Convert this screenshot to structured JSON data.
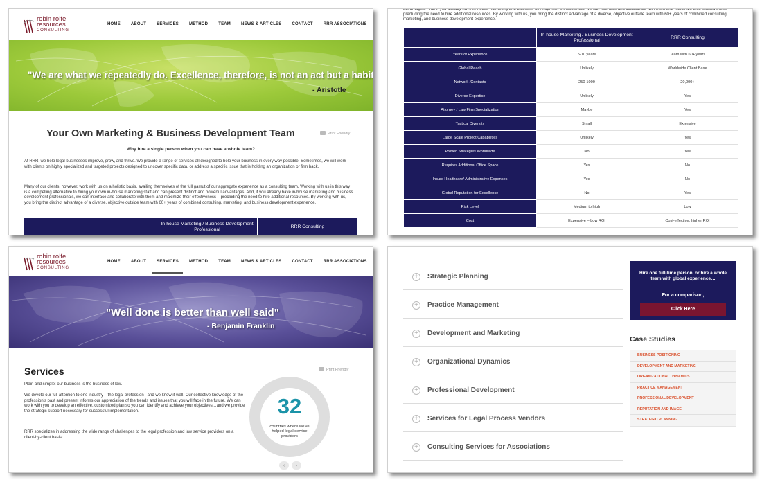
{
  "logo": {
    "line1": "robin rolfe",
    "line2": "resources",
    "line3": "CONSULTING"
  },
  "nav": [
    "HOME",
    "ABOUT",
    "SERVICES",
    "METHOD",
    "TEAM",
    "NEWS & ARTICLES",
    "CONTACT",
    "RRR ASSOCIATIONS"
  ],
  "panel1": {
    "quote": "\"We are what we repeatedly do. Excellence, therefore, is not an act but a habit\"",
    "author": "- Aristotle",
    "title": "Your Own Marketing & Business Development Team",
    "print": "Print Friendly",
    "subhead": "Why hire a single person when you can have a whole team?",
    "para1": "At RRR, we help legal businesses improve, grow, and thrive.  We provide a range of services all designed to help your business in every way possible. Sometimes, we will work with clients on highly specialized and targeted projects designed to uncover specific data, or address a specific issue that is holding an organization or firm back.",
    "para2": "Many of our clients, however, work with us on a holistic basis, availing themselves of the full gamut of our aggregate experience as a consulting team.   Working with us in this way is a compelling alternative to hiring your own in-house marketing staff and can present distinct and powerful advantages.  And, if you already have in-house marketing and business development professionals, we can interface and collaborate with them and maximize their effectiveness – precluding the need to hire additional resources. By working with us, you bring the distinct advantage of a diverse, objective outside team with 60+ years of combined consulting, marketing, and business development experience.",
    "table_head": [
      "",
      "In-house Marketing / Business Development Professional",
      "RRR Consulting"
    ]
  },
  "panel2": {
    "top_text": "advantages.  And, if you already have in-house marketing and business development professionals, we can interface and collaborate with them and maximize their effectiveness – precluding the need to hire additional resources. By working with us, you bring the distinct advantage of a diverse, objective outside team with 60+ years of combined consulting, marketing, and business development experience.",
    "headers": [
      "",
      "In-house Marketing / Business Development Professional",
      "RRR Consulting"
    ],
    "rows": [
      [
        "Years of Experience",
        "5-10 years",
        "Team with 60+  years"
      ],
      [
        "Global Reach",
        "Unlikely",
        "Worldwide Client Base"
      ],
      [
        "Network /Contacts",
        "250-1000",
        "20,000+"
      ],
      [
        "Diverse Expertise",
        "Unlikely",
        "Yes"
      ],
      [
        "Attorney / Law Firm Specialization",
        "Maybe",
        "Yes"
      ],
      [
        "Tactical Diversity",
        "Small",
        "Extensive"
      ],
      [
        "Large Scale Project Capabilities",
        "Unlikely",
        "Yes"
      ],
      [
        "Proven Strategies Worldwide",
        "No",
        "Yes"
      ],
      [
        "Requires Additional Office Space",
        "Yes",
        "No"
      ],
      [
        "Incurs Healthcare/ Administrative Expenses",
        "Yes",
        "No"
      ],
      [
        "Global Reputation for Excellence",
        "No",
        "Yes"
      ],
      [
        "Risk Level",
        "Medium to high",
        "Low"
      ],
      [
        "Cost",
        "Expensive – Low ROI",
        "Cost-effective, higher ROI"
      ]
    ]
  },
  "panel3": {
    "quote": "\"Well done is better than well said\"",
    "author": "- Benjamin Franklin",
    "title": "Services",
    "print": "Print Friendly",
    "para1": "Plain and simple: our business is the business of law.",
    "para2": "We devote our full attention to one industry – the legal profession –and  we know it well. Our collective knowledge of the profession's past and present informs our appreciation of the trends and issues that you will face in the future. We can work with you to develop an effective, customized plan so you can identify and achieve your objectives…and we provide the strategic support necessary for successful implementation.",
    "para3": "RRR specializes in addressing the wide range of challenges to the legal profession and law service providers on a client-by-client basis:",
    "stat_number": "32",
    "stat_caption": "countries where we've helped legal service providers",
    "prev": "‹",
    "next": "›"
  },
  "panel4": {
    "accordion": [
      "Strategic Planning",
      "Practice Management",
      "Development and Marketing",
      "Organizational Dynamics",
      "Professional Development",
      "Services for Legal Process Vendors",
      "Consulting Services for Associations"
    ],
    "promo_text": "Hire one full-time person, or hire a whole team with global experience…",
    "promo_sub": "For a comparison,",
    "promo_button": "Click Here",
    "case_title": "Case Studies",
    "case_items": [
      "BUSINESS POSITIONING",
      "DEVELOPMENT AND MARKETING",
      "ORGANIZATIONAL DYNAMICS",
      "PRACTICE MANAGEMENT",
      "PROFESSIONAL DEVELOPMENT",
      "REPUTATION AND IMAGE",
      "STRATEGIC PLANNING"
    ]
  },
  "colors": {
    "navy": "#1c1a5c",
    "maroon": "#7a1530",
    "teal": "#1b93a8",
    "green": "#9cc93a",
    "purple": "#5a5099",
    "orange": "#d94f2b"
  }
}
